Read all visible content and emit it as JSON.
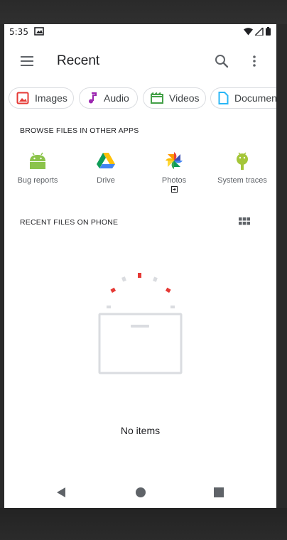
{
  "status_bar": {
    "time": "5:35",
    "icons": [
      "notification-icon",
      "wifi-icon",
      "signal-icon",
      "battery-icon"
    ]
  },
  "app_bar": {
    "title": "Recent",
    "icons": [
      "menu-icon",
      "search-icon",
      "more-vert-icon"
    ]
  },
  "filter_chips": [
    {
      "label": "Images",
      "icon": "image-icon",
      "color": "#e53935"
    },
    {
      "label": "Audio",
      "icon": "music-note-icon",
      "color": "#9c27b0"
    },
    {
      "label": "Videos",
      "icon": "movie-icon",
      "color": "#43a047"
    },
    {
      "label": "Documen",
      "icon": "document-icon",
      "color": "#29b6f6"
    }
  ],
  "browse_section": {
    "heading": "BROWSE FILES IN OTHER APPS",
    "apps": [
      {
        "label": "Bug reports",
        "icon": "android-icon"
      },
      {
        "label": "Drive",
        "icon": "google-drive-icon"
      },
      {
        "label": "Photos",
        "icon": "google-photos-icon",
        "badge_icon": "open-in-app-icon"
      },
      {
        "label": "System traces",
        "icon": "android-bug-icon"
      }
    ]
  },
  "recent_section": {
    "heading": "RECENT FILES ON PHONE",
    "view_toggle_icon": "grid-view-icon"
  },
  "empty_state": {
    "text": "No items",
    "illustration": "empty-folder-illustration"
  },
  "nav_bar": {
    "icons": [
      "back-icon",
      "home-icon",
      "recents-icon"
    ]
  },
  "colors": {
    "accent_red": "#e53935",
    "chip_border": "#dadce0",
    "secondary_text": "#5f6368"
  }
}
